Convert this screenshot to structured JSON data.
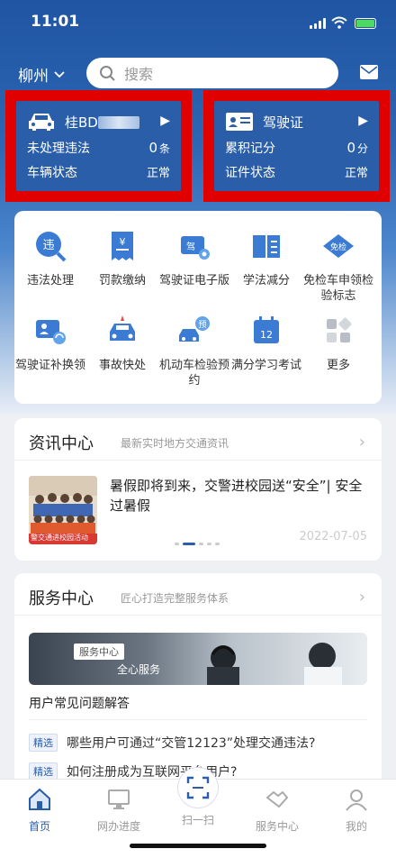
{
  "status_bar": {
    "time": "11:01"
  },
  "header": {
    "city": "柳州",
    "search_placeholder": "搜索"
  },
  "vehicle_card": {
    "plate_prefix": "桂BD",
    "violations_label": "未处理违法",
    "violations_value": "0",
    "violations_unit": "条",
    "status_label": "车辆状态",
    "status_value": "正常"
  },
  "license_card": {
    "title": "驾驶证",
    "points_label": "累积记分",
    "points_value": "0",
    "points_unit": "分",
    "status_label": "证件状态",
    "status_value": "正常"
  },
  "services": [
    {
      "label": "违法处理",
      "icon": "violation-icon"
    },
    {
      "label": "罚款缴纳",
      "icon": "fine-payment-icon"
    },
    {
      "label": "驾驶证电子版",
      "icon": "e-license-icon"
    },
    {
      "label": "学法减分",
      "icon": "study-book-icon"
    },
    {
      "label": "免检车申领检验标志",
      "icon": "inspection-exempt-icon"
    },
    {
      "label": "驾驶证补换领",
      "icon": "license-replace-icon"
    },
    {
      "label": "事故快处",
      "icon": "accident-icon"
    },
    {
      "label": "机动车检验预约",
      "icon": "inspection-booking-icon"
    },
    {
      "label": "满分学习考试",
      "icon": "calendar-exam-icon"
    },
    {
      "label": "更多",
      "icon": "more-icon"
    }
  ],
  "news": {
    "title": "资讯中心",
    "subtitle": "最新实时地方交通资讯",
    "headline": "暑假即将到来，交警进校园送“安全”| 安全过暑假",
    "image_caption": "警交通进校园活动",
    "date": "2022-07-05"
  },
  "service_center": {
    "title": "服务中心",
    "subtitle": "匠心打造完整服务体系",
    "banner_tag": "服务中心",
    "banner_text": "全心服务",
    "faq_heading": "用户常见问题解答",
    "faq_chip": "精选",
    "faqs": [
      "哪些用户可通过“交管12123”处理交通违法?",
      "如何注册成为互联网平台用户?"
    ]
  },
  "tabbar": {
    "tabs": [
      "首页",
      "网办进度",
      "扫一扫",
      "服务中心",
      "我的"
    ],
    "active": "首页"
  },
  "colors": {
    "brand": "#2a5ea8",
    "highlight_box": "#e00000",
    "status_ok": "#4cd964"
  }
}
